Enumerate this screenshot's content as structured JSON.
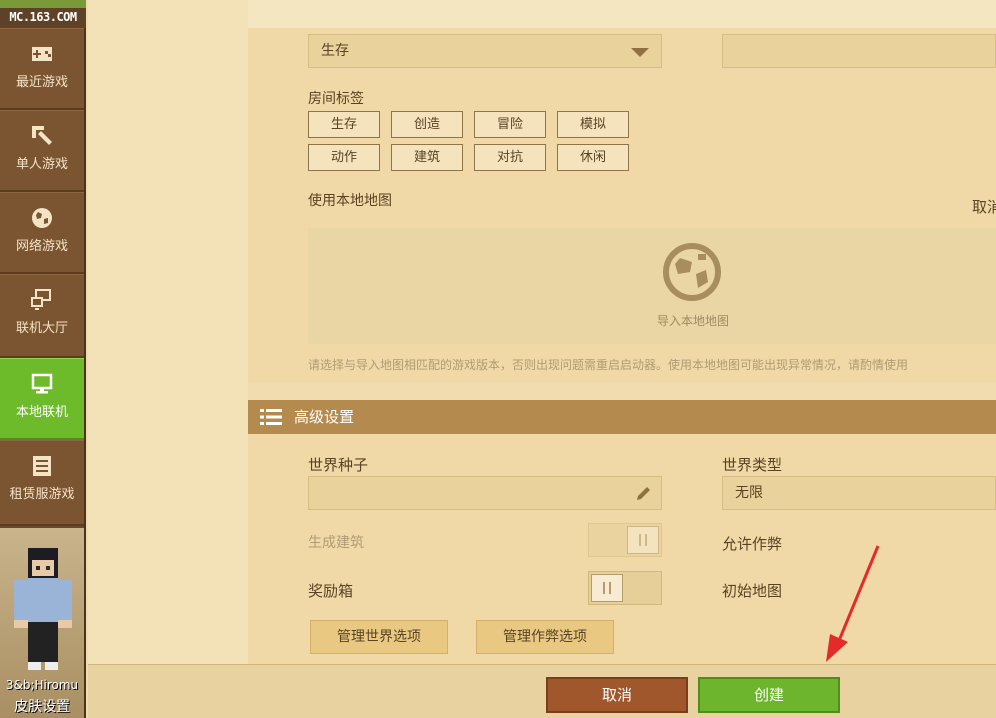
{
  "sidebar": {
    "logo": "MC.163.COM",
    "items": [
      {
        "label": "最近游戏",
        "icon": "gamepad-icon"
      },
      {
        "label": "单人游戏",
        "icon": "pickaxe-icon"
      },
      {
        "label": "网络游戏",
        "icon": "globe-icon"
      },
      {
        "label": "联机大厅",
        "icon": "network-icon"
      },
      {
        "label": "本地联机",
        "icon": "monitor-icon",
        "active": true
      },
      {
        "label": "租赁服游戏",
        "icon": "server-list-icon"
      }
    ],
    "skin": {
      "name": "3&b;Hiromu",
      "label": "皮肤设置"
    }
  },
  "room": {
    "mode_value": "生存",
    "tags_label": "房间标签",
    "tags": [
      "生存",
      "创造",
      "冒险",
      "模拟",
      "动作",
      "建筑",
      "对抗",
      "休闲"
    ],
    "local_map_label": "使用本地地图",
    "cancel_link": "取消",
    "import_text": "导入本地地图",
    "hint": "请选择与导入地图相匹配的游戏版本，否则出现问题需重启启动器。使用本地地图可能出现异常情况，请酌情使用"
  },
  "advanced": {
    "title": "高级设置",
    "seed_label": "世界种子",
    "seed_value": "",
    "world_type_label": "世界类型",
    "world_type_value": "无限",
    "generate_buildings_label": "生成建筑",
    "allow_cheats_label": "允许作弊",
    "bonus_chest_label": "奖励箱",
    "starting_map_label": "初始地图",
    "manage_world_button": "管理世界选项",
    "manage_cheats_button": "管理作弊选项"
  },
  "footer": {
    "cancel_button": "取消",
    "create_button": "创建"
  },
  "colors": {
    "accent_green": "#6cb52c",
    "cancel_brown": "#a0572b",
    "header_brown": "#b58a4e",
    "annotation_red": "#e52a2a"
  }
}
